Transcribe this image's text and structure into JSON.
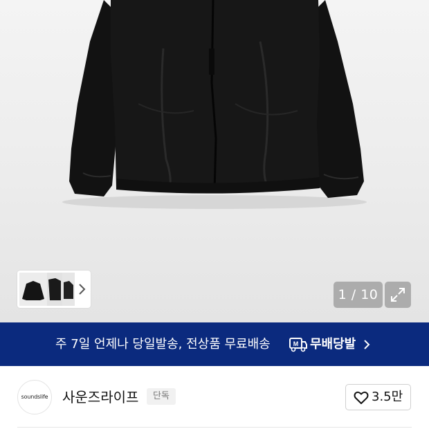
{
  "gallery": {
    "counter": "1 / 10",
    "thumbnail_count": 3
  },
  "banner": {
    "text": "주 7일 언제나 당일발송, 전상품 무료배송",
    "brand": "무배당발",
    "logo_letter": "M",
    "background_color": "#0b2a7e"
  },
  "seller": {
    "logo_text": "soundslife",
    "name": "사운즈라이프",
    "badge": "단독",
    "likes": "3.5만"
  },
  "icons": {
    "thumbs_next": "chevron-right-icon",
    "expand": "expand-icon",
    "banner_next": "chevron-right-icon",
    "like": "heart-outline-icon",
    "banner_logo": "delivery-truck-icon"
  }
}
